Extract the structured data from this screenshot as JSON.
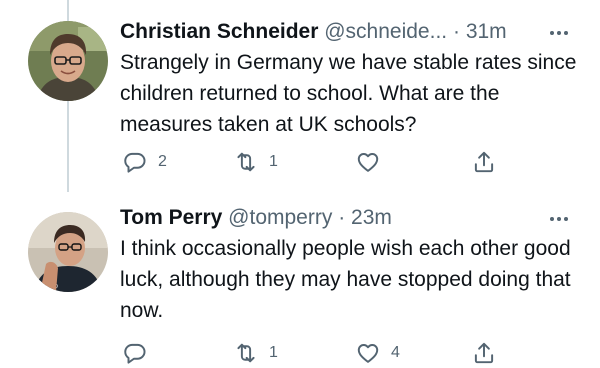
{
  "tweets": [
    {
      "display_name": "Christian Schneider",
      "handle": "@schneide...",
      "separator": "·",
      "time": "31m",
      "text": "Strangely in Germany we have stable rates since children returned to school. What are the measures taken at UK schools?",
      "reply_count": "2",
      "retweet_count": "1",
      "like_count": ""
    },
    {
      "display_name": "Tom Perry",
      "handle": "@tomperry",
      "separator": "·",
      "time": "23m",
      "text": "I think occasionally people wish each other good luck, although they may have stopped doing that now.",
      "reply_count": "",
      "retweet_count": "1",
      "like_count": "4"
    }
  ],
  "icons": {
    "reply": "reply-icon",
    "retweet": "retweet-icon",
    "like": "heart-icon",
    "share": "share-icon",
    "more": "more-icon"
  },
  "colors": {
    "text_primary": "#0f1419",
    "text_secondary": "#536471",
    "thread_line": "#cfd9de"
  }
}
